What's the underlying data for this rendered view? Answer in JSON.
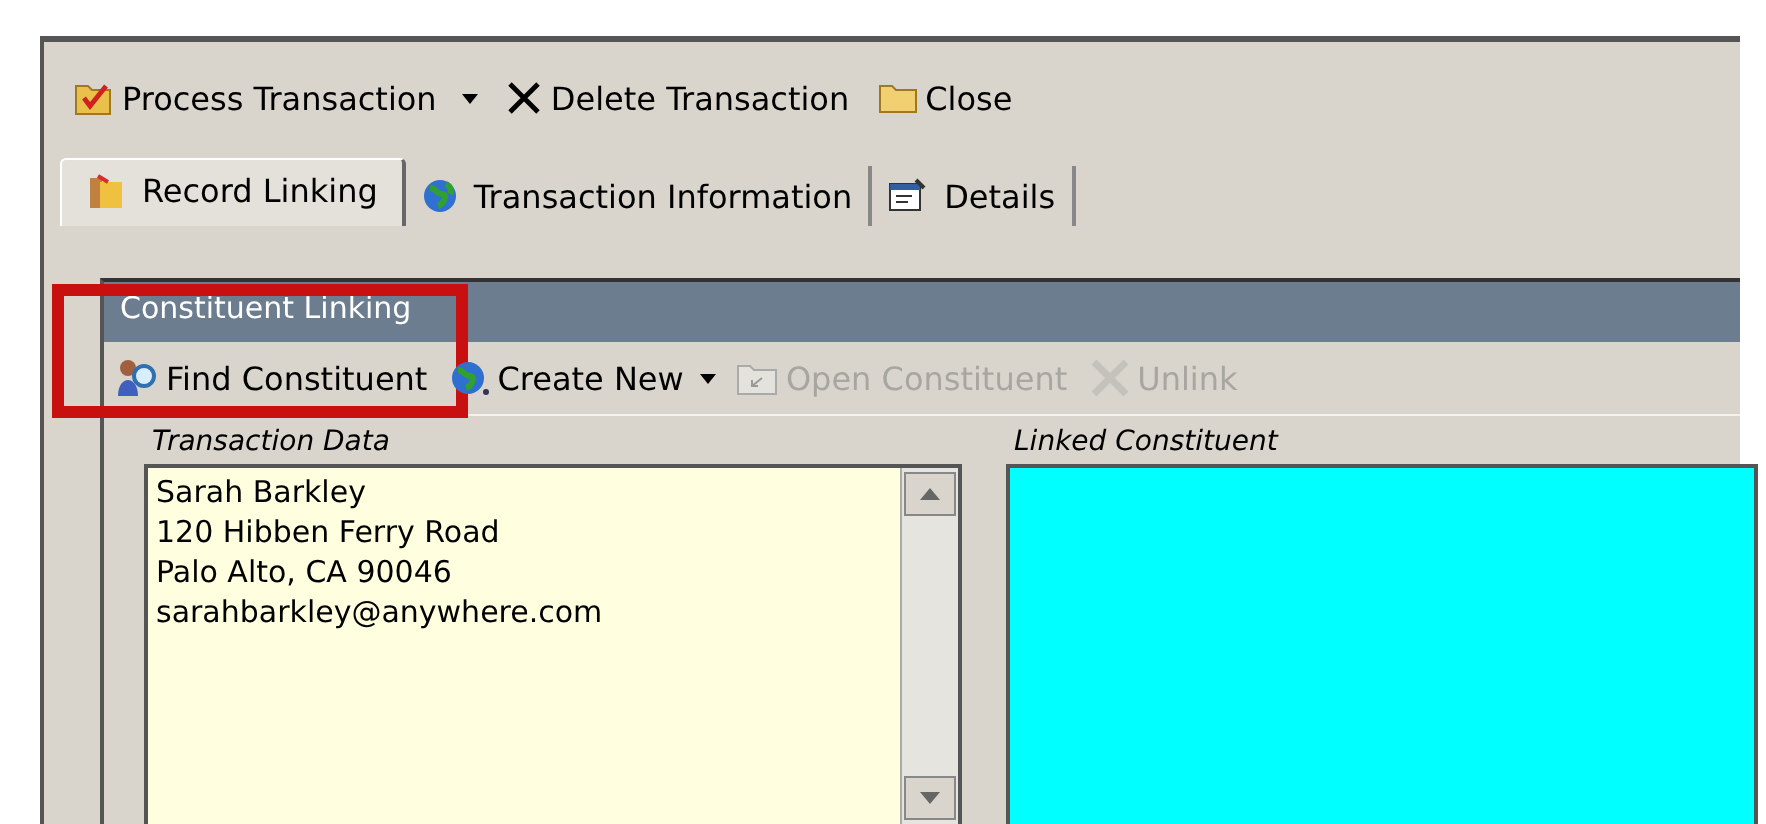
{
  "toolbar": [
    {
      "kind": "process",
      "label": "Process Transaction",
      "dropdown": true
    },
    {
      "kind": "delete",
      "label": "Delete Transaction",
      "dropdown": false
    },
    {
      "kind": "close",
      "label": "Close",
      "dropdown": false
    }
  ],
  "tabs": [
    {
      "kind": "record",
      "label": "Record Linking",
      "selected": true
    },
    {
      "kind": "globe",
      "label": "Transaction Information",
      "selected": false
    },
    {
      "kind": "details",
      "label": "Details",
      "selected": false
    }
  ],
  "panel": {
    "title": "Constituent Linking",
    "actions": [
      {
        "kind": "find",
        "label": "Find Constituent",
        "dropdown": false,
        "disabled": false,
        "highlighted": true
      },
      {
        "kind": "create",
        "label": "Create New",
        "dropdown": true,
        "disabled": false,
        "highlighted": false
      },
      {
        "kind": "open",
        "label": "Open Constituent",
        "dropdown": false,
        "disabled": true,
        "highlighted": false
      },
      {
        "kind": "unlink",
        "label": "Unlink",
        "dropdown": false,
        "disabled": true,
        "highlighted": false
      }
    ],
    "transaction_data": {
      "label": "Transaction Data",
      "lines": [
        "Sarah Barkley",
        "120 Hibben Ferry Road",
        "Palo Alto, CA  90046",
        "sarahbarkley@anywhere.com"
      ]
    },
    "linked_constituent": {
      "label": "Linked Constituent"
    }
  }
}
